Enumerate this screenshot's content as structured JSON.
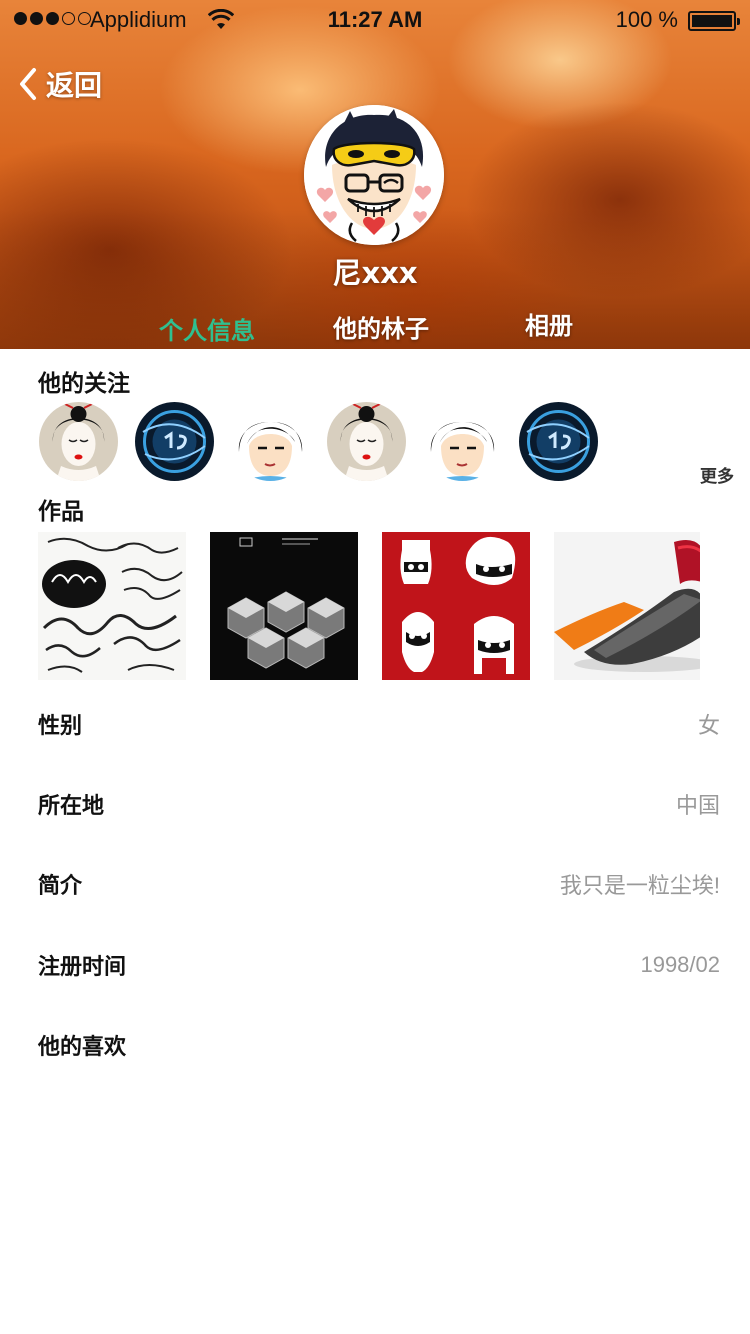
{
  "status_bar": {
    "carrier": "Applidium",
    "time": "11:27 AM",
    "battery": "100 %",
    "signal_bars_filled": 3,
    "signal_bars_total": 5
  },
  "nav": {
    "back_label": "返回",
    "back_icon": "chevron-left-icon"
  },
  "profile": {
    "name": "尼xxx",
    "avatar": "cartoon-masked-boy-avatar"
  },
  "tabs": [
    {
      "label": "个人信息",
      "active": true
    },
    {
      "label": "他的林子",
      "active": false
    },
    {
      "label": "相册",
      "active": false
    }
  ],
  "following": {
    "title": "他的关注",
    "more_label": "更多",
    "avatars": [
      "geisha-avatar",
      "blue-globe-avatar",
      "girl-cartoon-avatar",
      "geisha-avatar",
      "girl-cartoon-avatar",
      "blue-globe-avatar"
    ]
  },
  "works": {
    "title": "作品",
    "items": [
      "christmas-lettering-artwork",
      "cube-font-poster-artwork",
      "red-masks-artwork",
      "3d-shoe-render-artwork"
    ]
  },
  "info": [
    {
      "label": "性别",
      "value": "女"
    },
    {
      "label": "所在地",
      "value": "中国"
    },
    {
      "label": "简介",
      "value": "我只是一粒尘埃!"
    },
    {
      "label": "注册时间",
      "value": "1998/02"
    },
    {
      "label": "他的喜欢",
      "value": ""
    }
  ],
  "colors": {
    "accent_tab": "#2fbf8f",
    "hero_orange": "#d9671f",
    "value_gray": "#999999"
  }
}
